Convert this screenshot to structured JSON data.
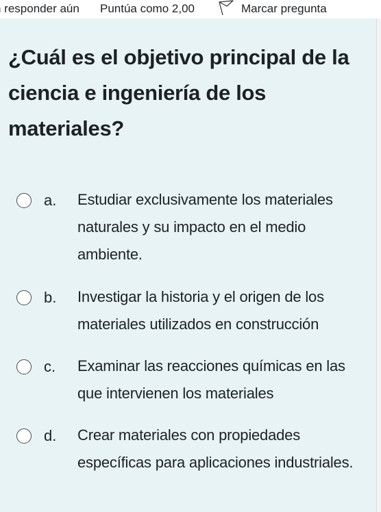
{
  "infobar": {
    "status": "n responder aún",
    "grade": "Puntúa como 2,00",
    "flag_label": "Marcar pregunta"
  },
  "question": {
    "text": "¿Cuál es el objetivo principal de la ciencia e ingeniería de los materiales?"
  },
  "options": [
    {
      "letter": "a.",
      "text": "Estudiar exclusivamente los materiales naturales y su impacto en el medio ambiente."
    },
    {
      "letter": "b.",
      "text": "Investigar la historia y el origen de los materiales utilizados en construcción"
    },
    {
      "letter": "c.",
      "text": "Examinar las reacciones químicas en las que intervienen los materiales"
    },
    {
      "letter": "d.",
      "text": "Crear materiales con propiedades específicas para aplicaciones industriales."
    }
  ],
  "icons": {
    "flag": "flag-icon",
    "radio": "radio-unchecked"
  },
  "colors": {
    "content_background": "#e7f3f5",
    "text": "#1d2125"
  }
}
